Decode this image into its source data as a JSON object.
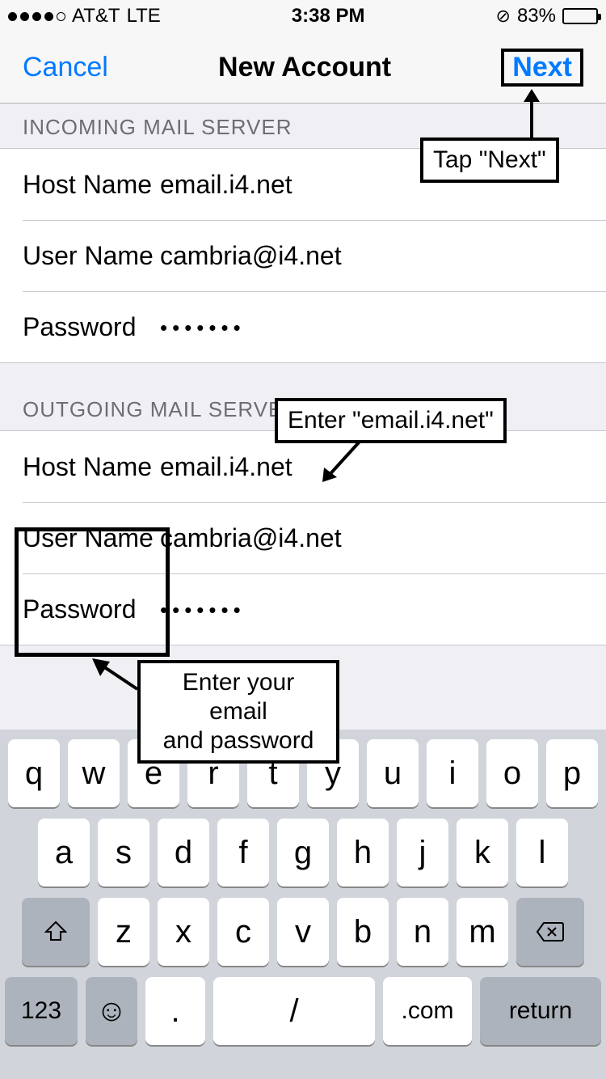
{
  "status": {
    "carrier": "AT&T",
    "network": "LTE",
    "time": "3:38 PM",
    "battery_pct": "83%"
  },
  "nav": {
    "cancel": "Cancel",
    "title": "New Account",
    "next": "Next"
  },
  "sections": {
    "incoming": {
      "header": "INCOMING MAIL SERVER",
      "host_label": "Host Name",
      "host_value": "email.i4.net",
      "user_label": "User Name",
      "user_value": "cambria@i4.net",
      "pass_label": "Password",
      "pass_value": "•••••••"
    },
    "outgoing": {
      "header": "OUTGOING MAIL SERVER",
      "host_label": "Host Name",
      "host_value": "email.i4.net",
      "user_label": "User Name",
      "user_value": "cambria@i4.net",
      "pass_label": "Password",
      "pass_value": "•••••••"
    }
  },
  "annotations": {
    "tap_next": "Tap \"Next\"",
    "enter_host": "Enter \"email.i4.net\"",
    "enter_creds_line1": "Enter your email",
    "enter_creds_line2": "and password"
  },
  "keyboard": {
    "row1": [
      "q",
      "w",
      "e",
      "r",
      "t",
      "y",
      "u",
      "i",
      "o",
      "p"
    ],
    "row2": [
      "a",
      "s",
      "d",
      "f",
      "g",
      "h",
      "j",
      "k",
      "l"
    ],
    "row3": [
      "z",
      "x",
      "c",
      "v",
      "b",
      "n",
      "m"
    ],
    "num": "123",
    "dot": ".",
    "slash": "/",
    "com": ".com",
    "return": "return"
  }
}
